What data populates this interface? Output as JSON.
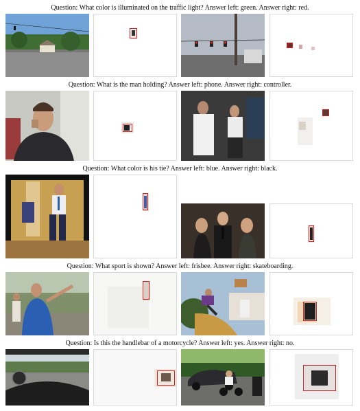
{
  "captions": [
    "Question: What color is illuminated on the traffic light? Answer left: green. Answer right: red.",
    "Question: What is the man holding? Answer left: phone. Answer right: controller.",
    "Question: What color is his tie? Answer left: blue. Answer right: black.",
    "Question: What sport is shown? Answer left: frisbee. Answer right: skateboarding.",
    "Question: Is this the handlebar of a motorcycle? Answer left: yes. Answer right: no."
  ],
  "colors": {
    "box_outline": "#d02020"
  }
}
